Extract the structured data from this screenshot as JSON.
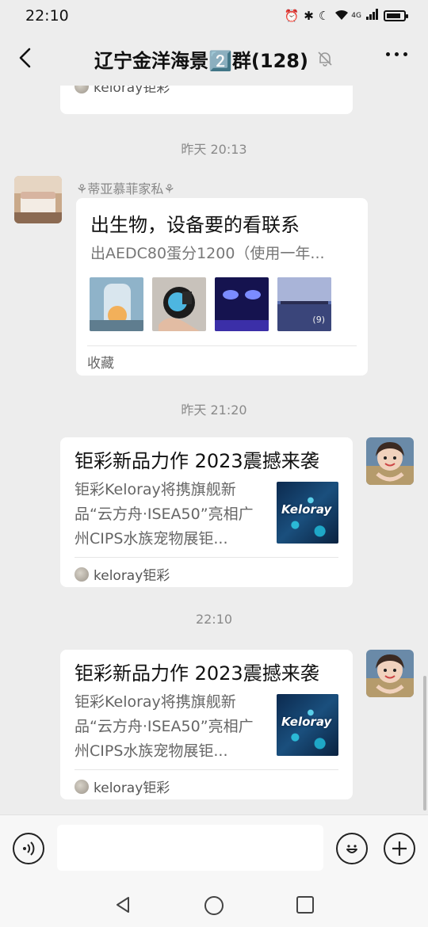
{
  "status": {
    "time": "22:10",
    "network": "4G"
  },
  "header": {
    "title": "辽宁金洋海景2️⃣群(128)"
  },
  "messages": {
    "top_card_source": "keloray钜彩",
    "time1": "昨天 20:13",
    "post": {
      "sender": "⚘蒂亚慕菲家私⚘",
      "title": "出生物，设备要的看联系",
      "subtitle": "出AEDC80蛋分1200（使用一年...",
      "image_count": "(9)",
      "footer": "收藏"
    },
    "time2": "昨天 21:20",
    "article1": {
      "title": "钜彩新品力作 2023震撼来袭",
      "desc": "钜彩Keloray将携旗舰新品“云方舟·ISEA50”亮相广州CIPS水族宠物展钜...",
      "thumb_text": "Keloray",
      "source": "keloray钜彩"
    },
    "time3": "22:10",
    "article2": {
      "title": "钜彩新品力作 2023震撼来袭",
      "desc": "钜彩Keloray将携旗舰新品“云方舟·ISEA50”亮相广州CIPS水族宠物展钜...",
      "thumb_text": "Keloray",
      "source": "keloray钜彩"
    }
  },
  "colors": {
    "background": "#ededed",
    "card": "#ffffff",
    "muted": "#8a8a8a"
  }
}
